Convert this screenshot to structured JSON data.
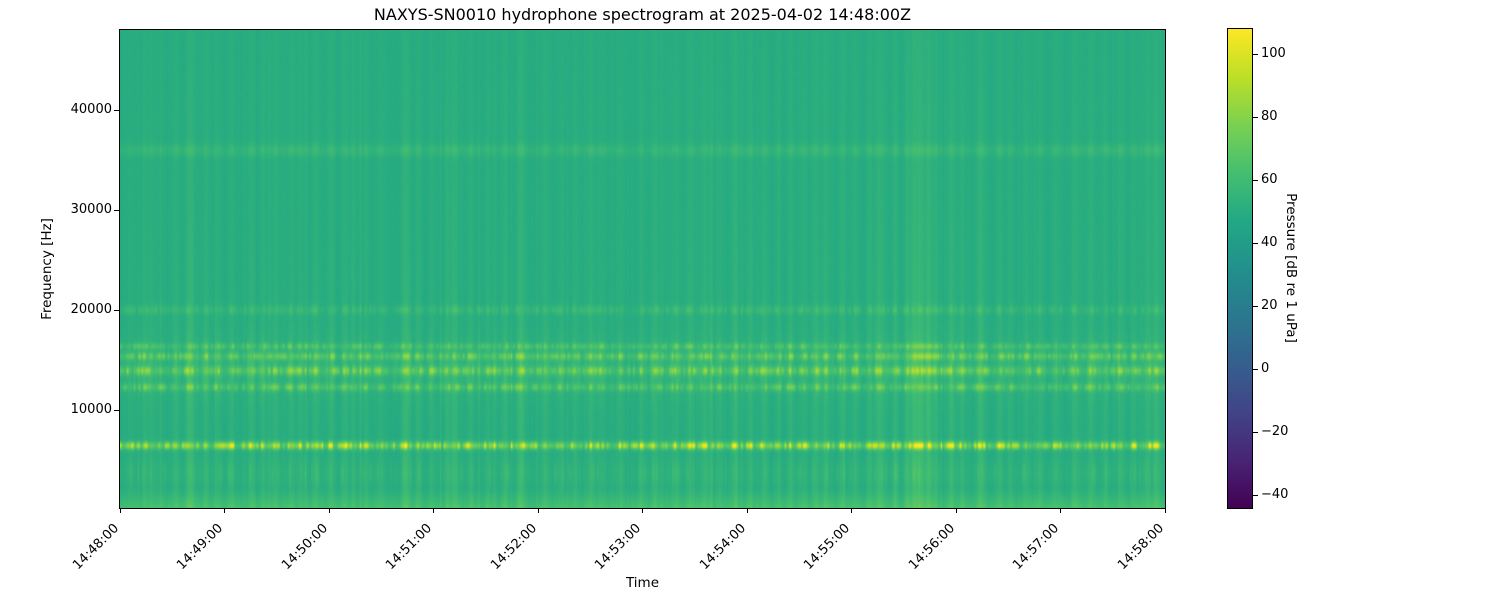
{
  "chart_data": {
    "type": "heatmap",
    "subtype": "spectrogram",
    "title": "NAXYS-SN0010 hydrophone spectrogram at 2025-04-02 14:48:00Z",
    "xlabel": "Time",
    "ylabel": "Frequency [Hz]",
    "x_ticks": [
      "14:48:00",
      "14:49:00",
      "14:50:00",
      "14:51:00",
      "14:52:00",
      "14:53:00",
      "14:54:00",
      "14:55:00",
      "14:56:00",
      "14:57:00",
      "14:58:00"
    ],
    "x_range_seconds": [
      0,
      600
    ],
    "y_ticks": [
      10000,
      20000,
      30000,
      40000
    ],
    "y_range_hz": [
      200,
      48000
    ],
    "grid": false,
    "legend": "none",
    "colorbar": {
      "label": "Pressure [dB re 1 uPa]",
      "ticks": [
        100,
        80,
        60,
        40,
        20,
        0,
        -20,
        -40
      ],
      "vmin": -44,
      "vmax": 108,
      "colormap": "viridis",
      "colormap_stops": [
        "#440154",
        "#482475",
        "#414487",
        "#355f8d",
        "#2a788e",
        "#21918c",
        "#22a884",
        "#44bf70",
        "#7ad151",
        "#bddf26",
        "#fde725"
      ]
    },
    "background_level_db": 49.5,
    "background_color": "#28ac80",
    "low_freq_boost": {
      "below_hz": 2200,
      "max_extra_db": 13
    },
    "tonal_bands": [
      {
        "freq_hz": 6400,
        "sigma_hz": 260,
        "peak_db": 36,
        "texture": "speckled"
      },
      {
        "freq_hz": 12250,
        "sigma_hz": 260,
        "peak_db": 15,
        "texture": "speckled"
      },
      {
        "freq_hz": 13900,
        "sigma_hz": 300,
        "peak_db": 19,
        "texture": "speckled"
      },
      {
        "freq_hz": 15350,
        "sigma_hz": 260,
        "peak_db": 17,
        "texture": "speckled"
      },
      {
        "freq_hz": 16350,
        "sigma_hz": 220,
        "peak_db": 13,
        "texture": "speckled"
      },
      {
        "freq_hz": 14200,
        "sigma_hz": 2000,
        "peak_db": 5,
        "texture": "speckled"
      },
      {
        "freq_hz": 20000,
        "sigma_hz": 320,
        "peak_db": 7,
        "texture": "speckled"
      },
      {
        "freq_hz": 36000,
        "sigma_hz": 450,
        "peak_db": 5,
        "texture": "smooth"
      },
      {
        "freq_hz": 3600,
        "sigma_hz": 900,
        "peak_db": 5,
        "texture": "sparse"
      }
    ],
    "broadband_events_s": [
      {
        "t": 5,
        "strength": 0.35
      },
      {
        "t": 14,
        "strength": 0.45
      },
      {
        "t": 18,
        "strength": 0.4
      },
      {
        "t": 23,
        "strength": 0.35
      },
      {
        "t": 32,
        "strength": 0.4
      },
      {
        "t": 40,
        "strength": 0.85
      },
      {
        "t": 49,
        "strength": 0.4
      },
      {
        "t": 56,
        "strength": 0.35
      },
      {
        "t": 64,
        "strength": 0.4
      },
      {
        "t": 75,
        "strength": 0.5
      },
      {
        "t": 82,
        "strength": 0.4
      },
      {
        "t": 89,
        "strength": 0.35
      },
      {
        "t": 98,
        "strength": 0.4
      },
      {
        "t": 103,
        "strength": 0.45
      },
      {
        "t": 112,
        "strength": 0.4
      },
      {
        "t": 121,
        "strength": 0.45
      },
      {
        "t": 129,
        "strength": 0.4
      },
      {
        "t": 141,
        "strength": 0.35
      },
      {
        "t": 149,
        "strength": 0.4
      },
      {
        "t": 164,
        "strength": 0.75
      },
      {
        "t": 171,
        "strength": 0.45
      },
      {
        "t": 179,
        "strength": 0.4
      },
      {
        "t": 188,
        "strength": 0.5
      },
      {
        "t": 192,
        "strength": 0.65
      },
      {
        "t": 201,
        "strength": 0.45
      },
      {
        "t": 211,
        "strength": 0.4
      },
      {
        "t": 221,
        "strength": 0.45
      },
      {
        "t": 230,
        "strength": 0.7
      },
      {
        "t": 244,
        "strength": 0.5
      },
      {
        "t": 253,
        "strength": 0.4
      },
      {
        "t": 261,
        "strength": 0.45
      },
      {
        "t": 270,
        "strength": 0.5
      },
      {
        "t": 276,
        "strength": 0.4
      },
      {
        "t": 287,
        "strength": 0.45
      },
      {
        "t": 299,
        "strength": 0.4
      },
      {
        "t": 307,
        "strength": 0.5
      },
      {
        "t": 319,
        "strength": 0.4
      },
      {
        "t": 327,
        "strength": 0.45
      },
      {
        "t": 336,
        "strength": 0.5
      },
      {
        "t": 344,
        "strength": 0.4
      },
      {
        "t": 353,
        "strength": 0.55
      },
      {
        "t": 362,
        "strength": 0.4
      },
      {
        "t": 370,
        "strength": 0.5
      },
      {
        "t": 378,
        "strength": 0.4
      },
      {
        "t": 385,
        "strength": 0.5
      },
      {
        "t": 392,
        "strength": 0.4
      },
      {
        "t": 399,
        "strength": 0.45
      },
      {
        "t": 405,
        "strength": 0.5
      },
      {
        "t": 414,
        "strength": 0.4
      },
      {
        "t": 422,
        "strength": 0.5
      },
      {
        "t": 430,
        "strength": 0.45
      },
      {
        "t": 436,
        "strength": 0.8
      },
      {
        "t": 445,
        "strength": 0.5
      },
      {
        "t": 452,
        "strength": 0.6
      },
      {
        "t": 456,
        "strength": 0.9
      },
      {
        "t": 459,
        "strength": 1.0
      },
      {
        "t": 464,
        "strength": 0.85
      },
      {
        "t": 468,
        "strength": 0.6
      },
      {
        "t": 477,
        "strength": 0.55
      },
      {
        "t": 483,
        "strength": 0.45
      },
      {
        "t": 494,
        "strength": 0.8
      },
      {
        "t": 505,
        "strength": 0.5
      },
      {
        "t": 511,
        "strength": 0.4
      },
      {
        "t": 520,
        "strength": 0.35
      },
      {
        "t": 528,
        "strength": 0.5
      },
      {
        "t": 537,
        "strength": 0.4
      },
      {
        "t": 548,
        "strength": 0.5
      },
      {
        "t": 557,
        "strength": 0.45
      },
      {
        "t": 566,
        "strength": 0.4
      },
      {
        "t": 574,
        "strength": 0.45
      },
      {
        "t": 582,
        "strength": 0.4
      },
      {
        "t": 590,
        "strength": 0.5
      },
      {
        "t": 595,
        "strength": 0.6
      }
    ]
  }
}
